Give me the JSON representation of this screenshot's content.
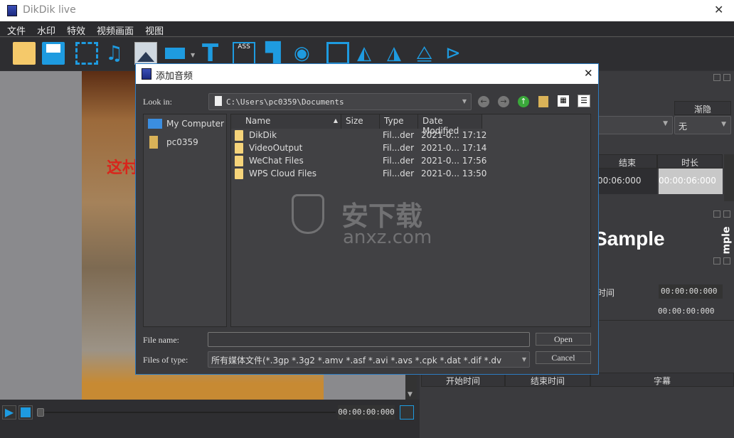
{
  "app": {
    "title": "DikDik live"
  },
  "menu": [
    "文件",
    "水印",
    "特效",
    "视频画面",
    "视图"
  ],
  "toolbar": {
    "icons": [
      "folder-open-icon",
      "save-icon",
      "film-icon",
      "music-icon",
      "image-icon",
      "rectangle-icon",
      "text-icon",
      "ass-subtitle-icon",
      "paint-roller-icon",
      "bucket-icon",
      "crop-icon",
      "rotate-left-icon",
      "rotate-right-icon",
      "flip-horizontal-icon",
      "flip-vertical-icon"
    ],
    "ass_label": "ASS"
  },
  "video": {
    "overlay_text": "这村"
  },
  "player": {
    "time": "00:00:00:000"
  },
  "right": {
    "fade_header": "渐隐",
    "fade_value": "无",
    "col_end": "结束",
    "col_duration": "时长",
    "end_value": "00:06:000",
    "duration_value": "00:00:06:000",
    "sample_text": "Sample",
    "sample_vertical": "mple",
    "time_label": "时间",
    "time_value": "00:00:00:000",
    "time_value2": "00:00:00:000",
    "subtitle_cols": [
      "开始时间",
      "结束时间",
      "字幕"
    ]
  },
  "dialog": {
    "title": "添加音频",
    "look_in_label": "Look in:",
    "path": "C:\\Users\\pc0359\\Documents",
    "places": [
      "My Computer",
      "pc0359"
    ],
    "columns": [
      "Name",
      "Size",
      "Type",
      "Date Modified"
    ],
    "files": [
      {
        "name": "DikDik",
        "type": "Fil...der",
        "date": "2021-0... 17:12"
      },
      {
        "name": "VideoOutput",
        "type": "Fil...der",
        "date": "2021-0... 17:14"
      },
      {
        "name": "WeChat Files",
        "type": "Fil...der",
        "date": "2021-0... 17:56"
      },
      {
        "name": "WPS Cloud Files",
        "type": "Fil...der",
        "date": "2021-0... 13:50"
      }
    ],
    "file_name_label": "File name:",
    "file_name_value": "",
    "files_of_type_label": "Files of type:",
    "files_of_type_value": "所有媒体文件(*.3gp *.3g2 *.amv *.asf *.avi *.avs *.cpk *.dat *.dif *.dv",
    "open": "Open",
    "cancel": "Cancel"
  },
  "watermark": {
    "text": "安下载",
    "sub": "anxz.com"
  },
  "colors": {
    "accent": "#1e9be0",
    "dialog_border": "#2d7cc1"
  }
}
